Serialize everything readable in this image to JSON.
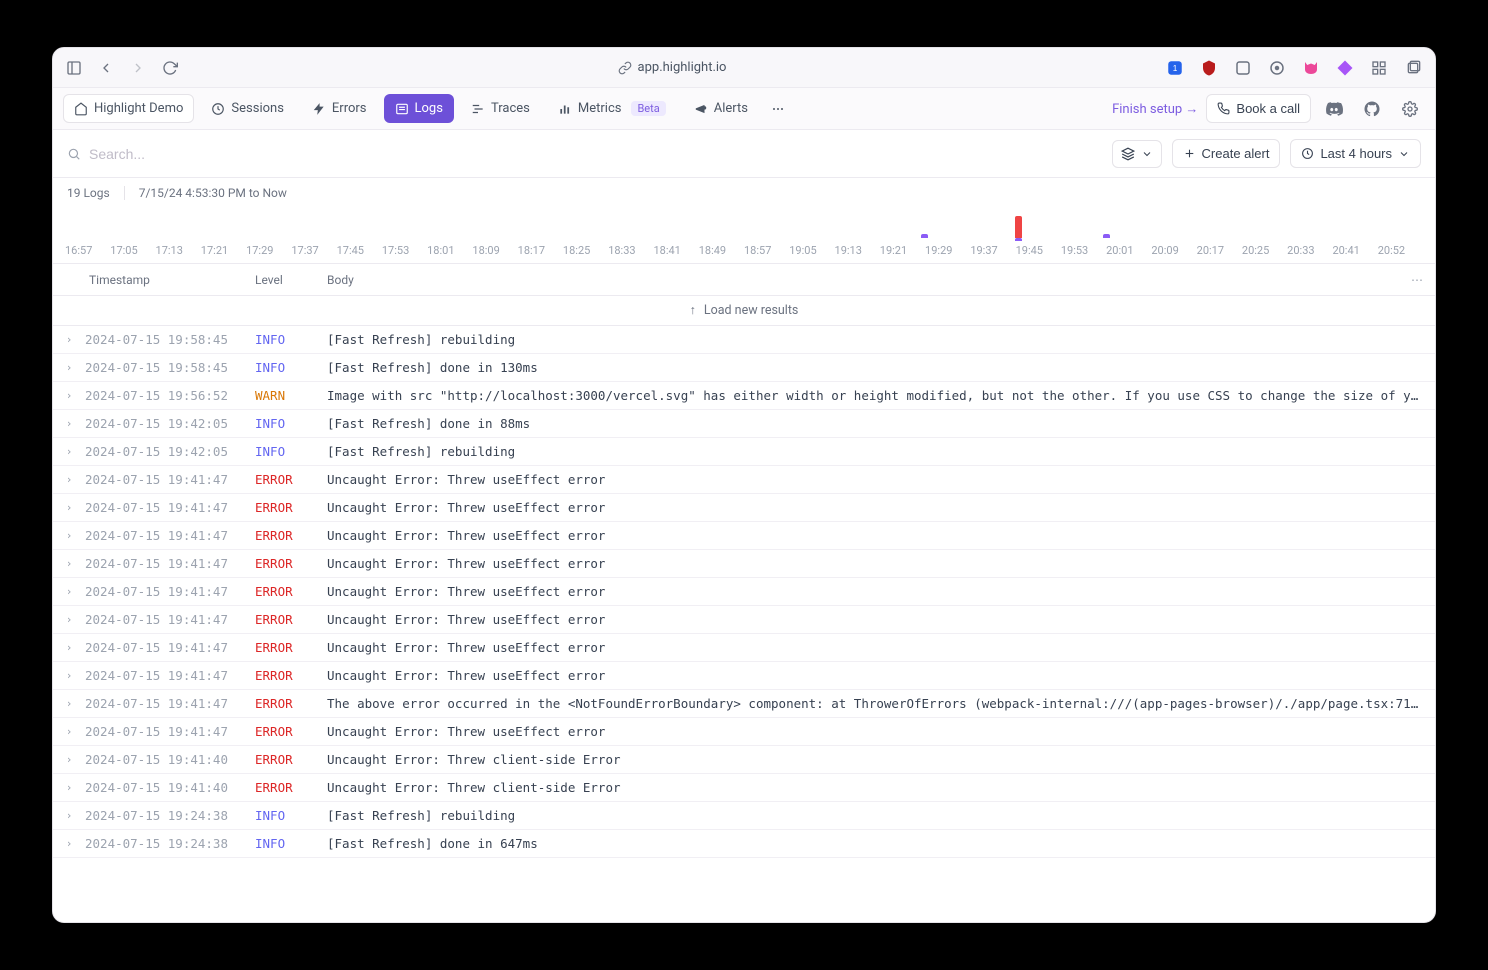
{
  "browser": {
    "address": "app.highlight.io"
  },
  "nav": {
    "project": "Highlight Demo",
    "items": [
      {
        "label": "Sessions"
      },
      {
        "label": "Errors"
      },
      {
        "label": "Logs"
      },
      {
        "label": "Traces"
      },
      {
        "label": "Metrics",
        "beta": "Beta"
      },
      {
        "label": "Alerts"
      }
    ],
    "finish_setup": "Finish setup →",
    "book_call": "Book a call"
  },
  "search": {
    "placeholder": "Search..."
  },
  "status": {
    "count": "19 Logs",
    "range": "7/15/24 4:53:30 PM to Now"
  },
  "toolbar": {
    "create_alert": "Create alert",
    "time_range": "Last 4 hours"
  },
  "timeline": {
    "ticks": [
      "16:57",
      "17:05",
      "17:13",
      "17:21",
      "17:29",
      "17:37",
      "17:45",
      "17:53",
      "18:01",
      "18:09",
      "18:17",
      "18:25",
      "18:33",
      "18:41",
      "18:49",
      "18:57",
      "19:05",
      "19:13",
      "19:21",
      "19:29",
      "19:37",
      "19:45",
      "19:53",
      "20:01",
      "20:09",
      "20:17",
      "20:25",
      "20:33",
      "20:41",
      "20:52"
    ]
  },
  "table": {
    "headers": {
      "ts": "Timestamp",
      "level": "Level",
      "body": "Body"
    },
    "load_new": "Load new results"
  },
  "logs": [
    {
      "ts": "2024-07-15 19:58:45",
      "level": "INFO",
      "body": "[Fast Refresh] rebuilding"
    },
    {
      "ts": "2024-07-15 19:58:45",
      "level": "INFO",
      "body": "[Fast Refresh] done in 130ms"
    },
    {
      "ts": "2024-07-15 19:56:52",
      "level": "WARN",
      "body": "Image with src \"http://localhost:3000/vercel.svg\" has either width or height modified, but not the other. If you use CSS to change the size of y…"
    },
    {
      "ts": "2024-07-15 19:42:05",
      "level": "INFO",
      "body": "[Fast Refresh] done in 88ms"
    },
    {
      "ts": "2024-07-15 19:42:05",
      "level": "INFO",
      "body": "[Fast Refresh] rebuilding"
    },
    {
      "ts": "2024-07-15 19:41:47",
      "level": "ERROR",
      "body": "Uncaught Error: Threw useEffect error"
    },
    {
      "ts": "2024-07-15 19:41:47",
      "level": "ERROR",
      "body": "Uncaught Error: Threw useEffect error"
    },
    {
      "ts": "2024-07-15 19:41:47",
      "level": "ERROR",
      "body": "Uncaught Error: Threw useEffect error"
    },
    {
      "ts": "2024-07-15 19:41:47",
      "level": "ERROR",
      "body": "Uncaught Error: Threw useEffect error"
    },
    {
      "ts": "2024-07-15 19:41:47",
      "level": "ERROR",
      "body": "Uncaught Error: Threw useEffect error"
    },
    {
      "ts": "2024-07-15 19:41:47",
      "level": "ERROR",
      "body": "Uncaught Error: Threw useEffect error"
    },
    {
      "ts": "2024-07-15 19:41:47",
      "level": "ERROR",
      "body": "Uncaught Error: Threw useEffect error"
    },
    {
      "ts": "2024-07-15 19:41:47",
      "level": "ERROR",
      "body": "Uncaught Error: Threw useEffect error"
    },
    {
      "ts": "2024-07-15 19:41:47",
      "level": "ERROR",
      "body": "The above error occurred in the <NotFoundErrorBoundary> component: at ThrowerOfErrors (webpack-internal:///(app-pages-browser)/./app/page.tsx:71…"
    },
    {
      "ts": "2024-07-15 19:41:47",
      "level": "ERROR",
      "body": "Uncaught Error: Threw useEffect error"
    },
    {
      "ts": "2024-07-15 19:41:40",
      "level": "ERROR",
      "body": "Uncaught Error: Threw client-side Error"
    },
    {
      "ts": "2024-07-15 19:41:40",
      "level": "ERROR",
      "body": "Uncaught Error: Threw client-side Error"
    },
    {
      "ts": "2024-07-15 19:24:38",
      "level": "INFO",
      "body": "[Fast Refresh] rebuilding"
    },
    {
      "ts": "2024-07-15 19:24:38",
      "level": "INFO",
      "body": "[Fast Refresh] done in 647ms"
    }
  ]
}
